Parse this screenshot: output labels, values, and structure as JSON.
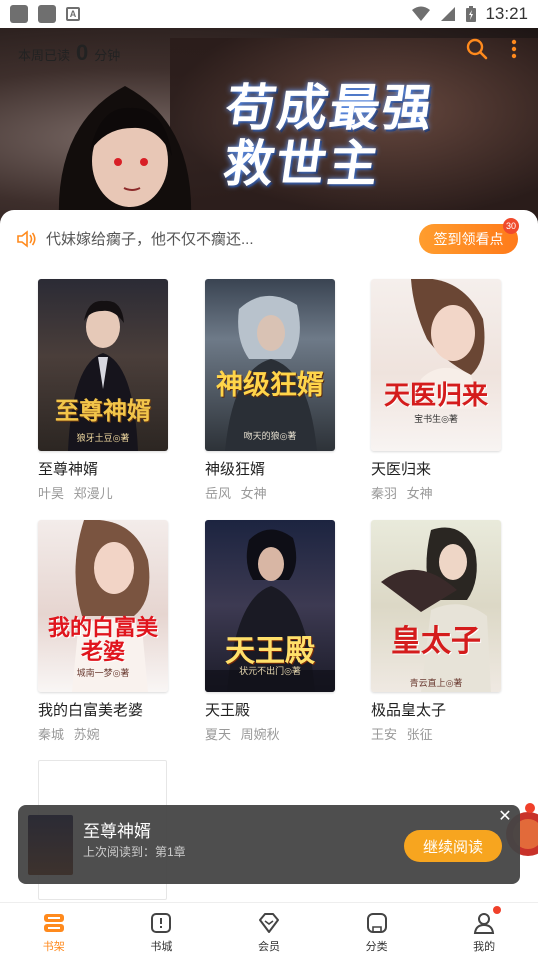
{
  "status_bar": {
    "time": "13:21"
  },
  "header": {
    "reading_prefix": "本周已读",
    "reading_value": "0",
    "reading_unit": "分钟",
    "banner_title_line1": "苟成最强",
    "banner_title_line2": "救世主"
  },
  "notice": {
    "text": "代妹嫁给瘸子，他不仅不瘸还..."
  },
  "checkin": {
    "label": "签到领看点",
    "badge": "30"
  },
  "books": [
    {
      "title": "至尊神婿",
      "meta": "叶昊 郑漫儿",
      "cover_title": "至尊神婿",
      "cover_author": "狼牙土豆◎著"
    },
    {
      "title": "神级狂婿",
      "meta": "岳风 女神",
      "cover_title": "神级狂婿",
      "cover_author": "吻天的狼◎著"
    },
    {
      "title": "天医归来",
      "meta": "秦羽 女神",
      "cover_title": "天医归来",
      "cover_author": "宝书生◎著"
    },
    {
      "title": "我的白富美老婆",
      "meta": "秦城 苏婉",
      "cover_title": "我的白富美老婆",
      "cover_author": "城南一梦◎著"
    },
    {
      "title": "天王殿",
      "meta": "夏天 周婉秋",
      "cover_title": "天王殿",
      "cover_author": "状元不出门◎著"
    },
    {
      "title": "极品皇太子",
      "meta": "王安 张征",
      "cover_title": "皇太子",
      "cover_author": "青云直上◎著"
    }
  ],
  "continue_reading": {
    "title": "至尊神婿",
    "subtitle": "上次阅读到：第1章",
    "button": "继续阅读",
    "close": "✕"
  },
  "nav": [
    {
      "label": "书架",
      "icon": "bookshelf-icon",
      "active": true
    },
    {
      "label": "书城",
      "icon": "bookstore-icon",
      "active": false
    },
    {
      "label": "会员",
      "icon": "diamond-icon",
      "active": false
    },
    {
      "label": "分类",
      "icon": "category-icon",
      "active": false
    },
    {
      "label": "我的",
      "icon": "profile-icon",
      "active": false
    }
  ],
  "colors": {
    "accent": "#ff8a1d",
    "continue_button": "#f7a51f",
    "badge": "#f04a2c"
  }
}
